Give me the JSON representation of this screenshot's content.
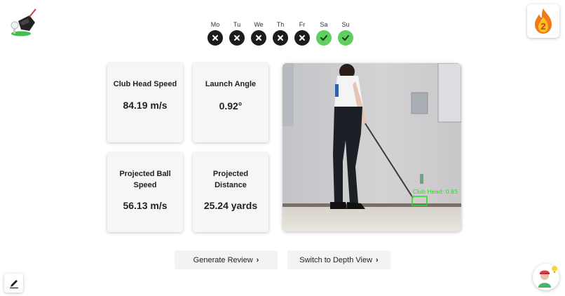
{
  "days": [
    {
      "label": "Mo",
      "status": "missed",
      "icon": "x-icon"
    },
    {
      "label": "Tu",
      "status": "missed",
      "icon": "x-icon"
    },
    {
      "label": "We",
      "status": "missed",
      "icon": "x-icon"
    },
    {
      "label": "Th",
      "status": "missed",
      "icon": "x-icon"
    },
    {
      "label": "Fr",
      "status": "missed",
      "icon": "x-icon"
    },
    {
      "label": "Sa",
      "status": "done",
      "icon": "check-icon"
    },
    {
      "label": "Su",
      "status": "done",
      "icon": "check-icon"
    }
  ],
  "streak": {
    "count": "2",
    "icon": "flame-icon"
  },
  "metrics": {
    "club_head_speed": {
      "label": "Club Head Speed",
      "value": "84.19 m/s"
    },
    "launch_angle": {
      "label": "Launch Angle",
      "value": "0.92°"
    },
    "ball_speed": {
      "label": "Projected Ball Speed",
      "value": "56.13 m/s"
    },
    "distance": {
      "label": "Projected Distance",
      "value": "25.24 yards"
    }
  },
  "video": {
    "detection_label": "Club Head: 0.65"
  },
  "buttons": {
    "review": "Generate Review",
    "depth": "Switch to Depth View",
    "chevron": "›"
  },
  "colors": {
    "missed": "#1c1c1c",
    "done": "#5fcf5f",
    "detection": "#22e022",
    "card_bg": "#f6f6f6",
    "button_bg": "#f3f3f3"
  }
}
